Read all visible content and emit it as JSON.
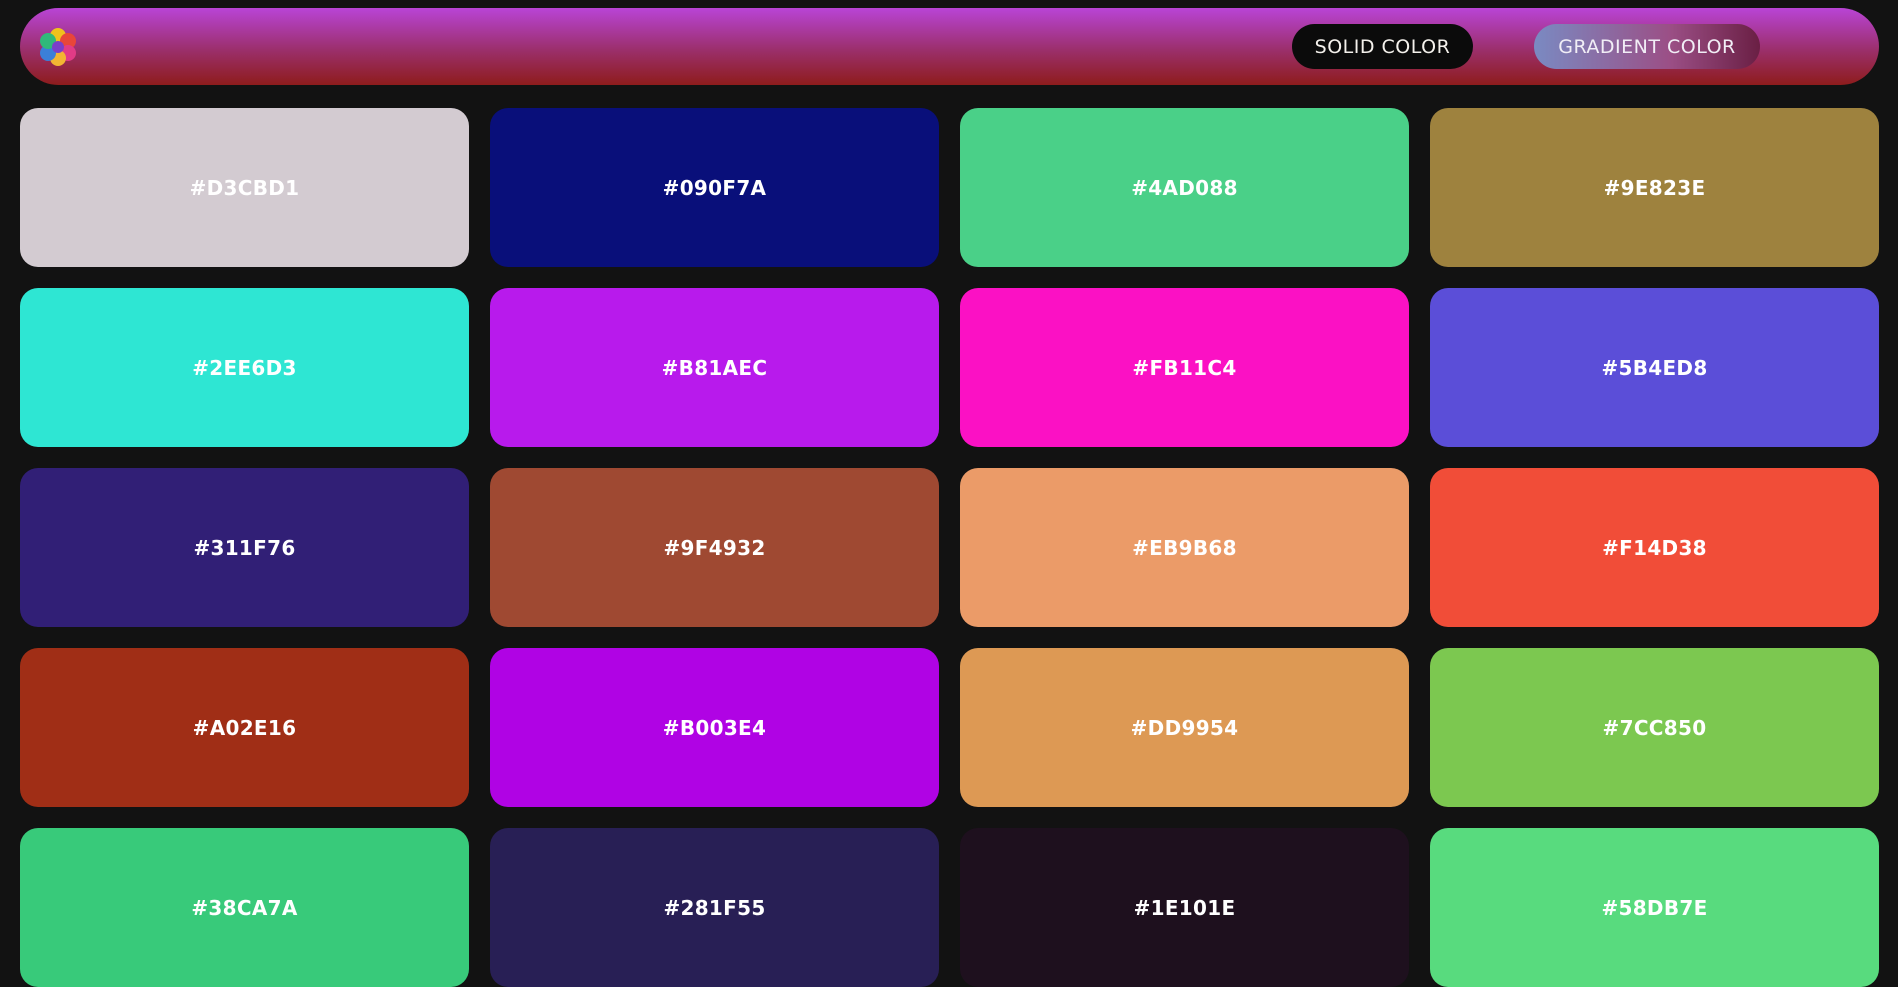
{
  "navbar": {
    "logo_icon": "flower-logo-icon",
    "solid_label": "SOLID COLOR",
    "gradient_label": "GRADIENT COLOR"
  },
  "colors": [
    "#D3CBD1",
    "#090F7A",
    "#4AD088",
    "#9E823E",
    "#2EE6D3",
    "#B81AEC",
    "#FB11C4",
    "#5B4ED8",
    "#311F76",
    "#9F4932",
    "#EB9B68",
    "#F14D38",
    "#A02E16",
    "#B003E4",
    "#DD9954",
    "#7CC850",
    "#38CA7A",
    "#281F55",
    "#1E101E",
    "#58DB7E"
  ]
}
